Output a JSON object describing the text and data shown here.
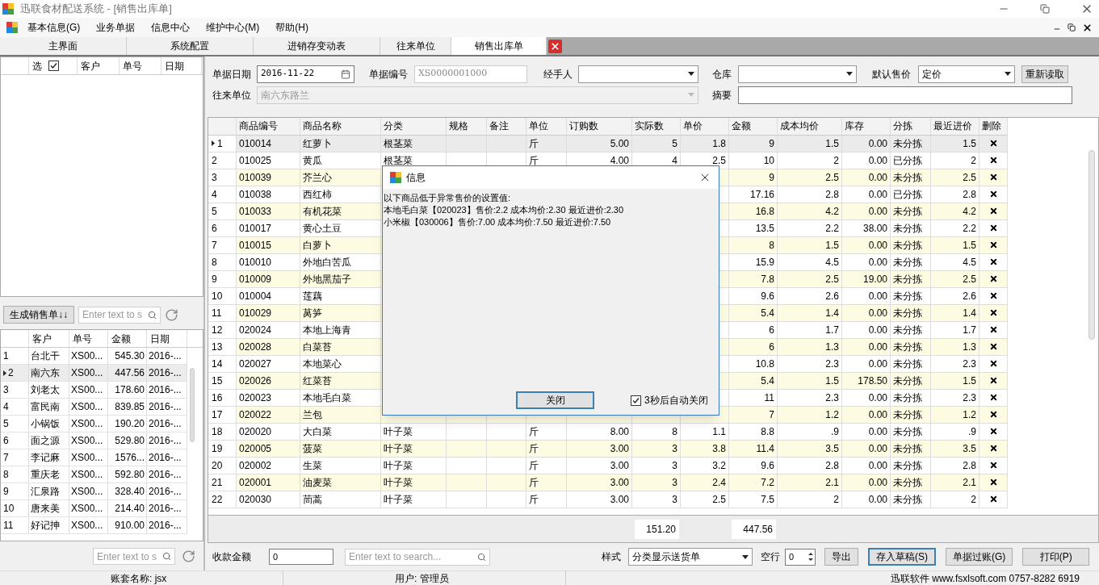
{
  "window": {
    "title": "迅联食材配送系统 - [销售出库单]"
  },
  "menu": [
    "基本信息(G)",
    "业务单据",
    "信息中心",
    "维护中心(M)",
    "帮助(H)"
  ],
  "tabs": [
    {
      "label": "主界面",
      "selected": false
    },
    {
      "label": "系统配置",
      "selected": false
    },
    {
      "label": "进销存变动表",
      "selected": false
    },
    {
      "label": "往来单位",
      "selected": false
    },
    {
      "label": "销售出库单",
      "selected": true
    }
  ],
  "left_panel": {
    "top_list": {
      "columns": [
        {
          "label": "选",
          "checked": true
        },
        {
          "label": "客户"
        },
        {
          "label": "单号"
        },
        {
          "label": "日期"
        }
      ]
    },
    "generate_button": "生成销售单↓↓",
    "search_placeholder": "Enter text to s",
    "list": {
      "columns": [
        "客户",
        "单号",
        "金额",
        "日期"
      ],
      "rows": [
        {
          "no": "1",
          "customer": "台北干",
          "number": "XS00...",
          "amount": "545.30",
          "date": "2016-...",
          "selected": false
        },
        {
          "no": "2",
          "customer": "南六东",
          "number": "XS00...",
          "amount": "447.56",
          "date": "2016-...",
          "selected": true
        },
        {
          "no": "3",
          "customer": "刘老太",
          "number": "XS00...",
          "amount": "178.60",
          "date": "2016-...",
          "selected": false
        },
        {
          "no": "4",
          "customer": "富民南",
          "number": "XS00...",
          "amount": "839.85",
          "date": "2016-...",
          "selected": false
        },
        {
          "no": "5",
          "customer": "小锅饭",
          "number": "XS00...",
          "amount": "190.20",
          "date": "2016-...",
          "selected": false
        },
        {
          "no": "6",
          "customer": "面之源",
          "number": "XS00...",
          "amount": "529.80",
          "date": "2016-...",
          "selected": false
        },
        {
          "no": "7",
          "customer": "李记麻",
          "number": "XS00...",
          "amount": "1576...",
          "date": "2016-...",
          "selected": false
        },
        {
          "no": "8",
          "customer": "重庆老",
          "number": "XS00...",
          "amount": "592.80",
          "date": "2016-...",
          "selected": false
        },
        {
          "no": "9",
          "customer": "汇泉路",
          "number": "XS00...",
          "amount": "328.40",
          "date": "2016-...",
          "selected": false
        },
        {
          "no": "10",
          "customer": "唐来美",
          "number": "XS00...",
          "amount": "214.40",
          "date": "2016-...",
          "selected": false
        },
        {
          "no": "11",
          "customer": "好记抻",
          "number": "XS00...",
          "amount": "910.00",
          "date": "2016-...",
          "selected": false
        }
      ]
    },
    "bottom_search_placeholder": "Enter text to s"
  },
  "form": {
    "date": {
      "label": "单据日期",
      "value": "2016-11-22"
    },
    "number": {
      "label": "单据编号",
      "value": "XS0000001000"
    },
    "handler": {
      "label": "经手人"
    },
    "warehouse": {
      "label": "仓库"
    },
    "default_price": {
      "label": "默认售价",
      "value": "定价"
    },
    "reload_button": "重新读取",
    "partner": {
      "label": "往来单位",
      "value": "南六东路兰",
      "disabled": true
    },
    "summary": {
      "label": "摘要"
    }
  },
  "table": {
    "columns": [
      "商品编号",
      "商品名称",
      "分类",
      "规格",
      "备注",
      "单位",
      "订购数",
      "实际数",
      "单价",
      "金额",
      "成本均价",
      "库存",
      "分拣",
      "最近进价",
      "删除"
    ],
    "rows": [
      {
        "no": "1",
        "selected": true,
        "code": "010014",
        "name": "红萝卜",
        "category": "根茎菜",
        "unit": "斤",
        "ordered": "5.00",
        "actual": "5",
        "price": "1.8",
        "amount": "9",
        "cost": "1.5",
        "stock": "0.00",
        "sorting": "未分拣",
        "last_price": "1.5"
      },
      {
        "no": "2",
        "selected": false,
        "code": "010025",
        "name": "黄瓜",
        "category": "根茎菜",
        "unit": "斤",
        "ordered": "4.00",
        "actual": "4",
        "price": "2.5",
        "amount": "10",
        "cost": "2",
        "stock": "0.00",
        "sorting": "已分拣",
        "last_price": "2"
      },
      {
        "no": "3",
        "selected": false,
        "code": "010039",
        "name": "芥兰心",
        "amount": "9",
        "cost": "2.5",
        "stock": "0.00",
        "sorting": "未分拣",
        "last_price": "2.5"
      },
      {
        "no": "4",
        "selected": false,
        "code": "010038",
        "name": "西红柿",
        "amount": "17.16",
        "cost": "2.8",
        "stock": "0.00",
        "sorting": "已分拣",
        "last_price": "2.8"
      },
      {
        "no": "5",
        "selected": false,
        "code": "010033",
        "name": "有机花菜",
        "amount": "16.8",
        "cost": "4.2",
        "stock": "0.00",
        "sorting": "未分拣",
        "last_price": "4.2"
      },
      {
        "no": "6",
        "selected": false,
        "code": "010017",
        "name": "黄心土豆",
        "amount": "13.5",
        "cost": "2.2",
        "stock": "38.00",
        "sorting": "未分拣",
        "last_price": "2.2"
      },
      {
        "no": "7",
        "selected": false,
        "code": "010015",
        "name": "白萝卜",
        "amount": "8",
        "cost": "1.5",
        "stock": "0.00",
        "sorting": "未分拣",
        "last_price": "1.5"
      },
      {
        "no": "8",
        "selected": false,
        "code": "010010",
        "name": "外地白苦瓜",
        "amount": "15.9",
        "cost": "4.5",
        "stock": "0.00",
        "sorting": "未分拣",
        "last_price": "4.5"
      },
      {
        "no": "9",
        "selected": false,
        "code": "010009",
        "name": "外地黑茄子",
        "amount": "7.8",
        "cost": "2.5",
        "stock": "19.00",
        "sorting": "未分拣",
        "last_price": "2.5"
      },
      {
        "no": "10",
        "selected": false,
        "code": "010004",
        "name": "莲藕",
        "amount": "9.6",
        "cost": "2.6",
        "stock": "0.00",
        "sorting": "未分拣",
        "last_price": "2.6"
      },
      {
        "no": "11",
        "selected": false,
        "code": "010029",
        "name": "莴笋",
        "amount": "5.4",
        "cost": "1.4",
        "stock": "0.00",
        "sorting": "未分拣",
        "last_price": "1.4"
      },
      {
        "no": "12",
        "selected": false,
        "code": "020024",
        "name": "本地上海青",
        "amount": "6",
        "cost": "1.7",
        "stock": "0.00",
        "sorting": "未分拣",
        "last_price": "1.7"
      },
      {
        "no": "13",
        "selected": false,
        "code": "020028",
        "name": "白菜苔",
        "amount": "6",
        "cost": "1.3",
        "stock": "0.00",
        "sorting": "未分拣",
        "last_price": "1.3"
      },
      {
        "no": "14",
        "selected": false,
        "code": "020027",
        "name": "本地菜心",
        "amount": "10.8",
        "cost": "2.3",
        "stock": "0.00",
        "sorting": "未分拣",
        "last_price": "2.3"
      },
      {
        "no": "15",
        "selected": false,
        "code": "020026",
        "name": "红菜苔",
        "amount": "5.4",
        "cost": "1.5",
        "stock": "178.50",
        "sorting": "未分拣",
        "last_price": "1.5"
      },
      {
        "no": "16",
        "selected": false,
        "code": "020023",
        "name": "本地毛白菜",
        "amount": "11",
        "cost": "2.3",
        "stock": "0.00",
        "sorting": "未分拣",
        "last_price": "2.3"
      },
      {
        "no": "17",
        "selected": false,
        "code": "020022",
        "name": "兰包",
        "amount": "7",
        "cost": "1.2",
        "stock": "0.00",
        "sorting": "未分拣",
        "last_price": "1.2"
      },
      {
        "no": "18",
        "selected": false,
        "code": "020020",
        "name": "大白菜",
        "category": "叶子菜",
        "unit": "斤",
        "ordered": "8.00",
        "actual": "8",
        "price": "1.1",
        "amount": "8.8",
        "cost": ".9",
        "stock": "0.00",
        "sorting": "未分拣",
        "last_price": ".9"
      },
      {
        "no": "19",
        "selected": false,
        "code": "020005",
        "name": "菠菜",
        "category": "叶子菜",
        "unit": "斤",
        "ordered": "3.00",
        "actual": "3",
        "price": "3.8",
        "amount": "11.4",
        "cost": "3.5",
        "stock": "0.00",
        "sorting": "未分拣",
        "last_price": "3.5"
      },
      {
        "no": "20",
        "selected": false,
        "code": "020002",
        "name": "生菜",
        "category": "叶子菜",
        "unit": "斤",
        "ordered": "3.00",
        "actual": "3",
        "price": "3.2",
        "amount": "9.6",
        "cost": "2.8",
        "stock": "0.00",
        "sorting": "未分拣",
        "last_price": "2.8"
      },
      {
        "no": "21",
        "selected": false,
        "code": "020001",
        "name": "油麦菜",
        "category": "叶子菜",
        "unit": "斤",
        "ordered": "3.00",
        "actual": "3",
        "price": "2.4",
        "amount": "7.2",
        "cost": "2.1",
        "stock": "0.00",
        "sorting": "未分拣",
        "last_price": "2.1"
      },
      {
        "no": "22",
        "selected": false,
        "code": "020030",
        "name": "茼蒿",
        "category": "叶子菜",
        "unit": "斤",
        "ordered": "3.00",
        "actual": "3",
        "price": "2.5",
        "amount": "7.5",
        "cost": "2",
        "stock": "0.00",
        "sorting": "未分拣",
        "last_price": "2"
      }
    ],
    "actual_total": "151.20",
    "amount_total": "447.56"
  },
  "bottom_bar": {
    "received": {
      "label": "收款金额",
      "value": "0"
    },
    "search_placeholder": "Enter text to search...",
    "style": {
      "label": "样式",
      "value": "分类显示送货单"
    },
    "blank_rows": {
      "label": "空行",
      "value": "0"
    },
    "buttons": [
      {
        "label": "导出",
        "focused": false
      },
      {
        "label": "存入草稿(S)",
        "focused": true
      },
      {
        "label": "单据过账(G)",
        "focused": false
      },
      {
        "label": "打印(P)",
        "focused": false
      }
    ]
  },
  "status_bar": [
    "账套名称: jsx",
    "用户: 管理员",
    "迅联软件 www.fsxlsoft.com 0757-8282 6919"
  ],
  "dialog": {
    "title": "信息",
    "lines": [
      "以下商品低于异常售价的设置值:",
      "本地毛白菜【020023】售价:2.2 成本均价:2.30 最近进价:2.30",
      "小米椒【030006】售价:7.00 成本均价:7.50 最近进价:7.50"
    ],
    "close_button": "关闭",
    "auto_close": {
      "label": "3秒后自动关闭",
      "checked": true
    }
  }
}
